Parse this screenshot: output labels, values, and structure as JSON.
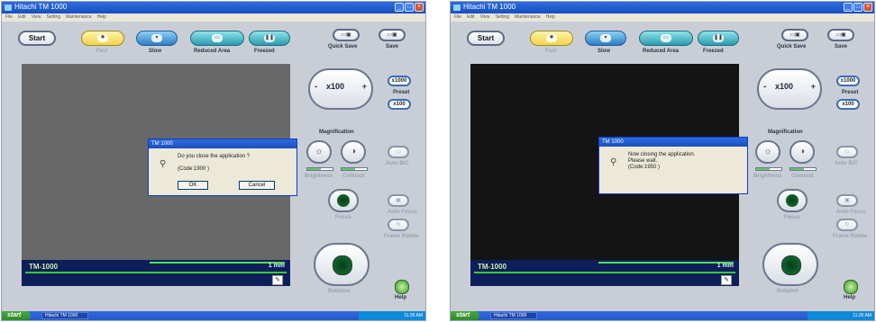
{
  "panels": [
    {
      "title": "Hitachi TM 1000",
      "menu": [
        "File",
        "Edit",
        "View",
        "Setting",
        "Maintenance",
        "Help"
      ],
      "toolbar": {
        "start": "Start",
        "fast": "Fast",
        "slow": "Slow",
        "reduced_area": "Reduced Area",
        "freezed": "Freezed",
        "quick_save": "Quick Save",
        "save": "Save"
      },
      "magnification": {
        "value": "x100",
        "minus": "-",
        "plus": "+",
        "label": "Magnification"
      },
      "preset": {
        "x1000": "x1000",
        "label": "Preset",
        "x100": "x100"
      },
      "controls": {
        "brightness": "Brightness",
        "contrast": "Contrast",
        "auto_bc": "Auto B/C",
        "focus": "Focus",
        "auto_focus": "Auto Focus",
        "frame_rotation": "Frame Rotate",
        "rotation": "Rotation",
        "help": "Help"
      },
      "status": {
        "model": "TM-1000",
        "scale": "1 mm"
      },
      "dialog": {
        "title": "TM 1000",
        "message": "Do you close the application ?",
        "code": "(Code:1900 )",
        "ok": "OK",
        "cancel": "Cancel"
      },
      "taskbar": {
        "start": "start",
        "task": "Hitachi TM 1000",
        "clock": "11:26 AM"
      }
    },
    {
      "title": "Hitachi TM 1000",
      "menu": [
        "File",
        "Edit",
        "View",
        "Setting",
        "Maintenance",
        "Help"
      ],
      "toolbar": {
        "start": "Start",
        "fast": "Fast",
        "slow": "Slow",
        "reduced_area": "Reduced Area",
        "freezed": "Freezed",
        "quick_save": "Quick Save",
        "save": "Save"
      },
      "magnification": {
        "value": "x100",
        "minus": "-",
        "plus": "+",
        "label": "Magnification"
      },
      "preset": {
        "x1000": "x1000",
        "label": "Preset",
        "x100": "x100"
      },
      "controls": {
        "brightness": "Brightness",
        "contrast": "Contrast",
        "auto_bc": "Auto B/C",
        "focus": "Focus",
        "auto_focus": "Auto Focus",
        "frame_rotation": "Frame Rotate",
        "rotation": "Rotation",
        "help": "Help"
      },
      "status": {
        "model": "TM-1000",
        "scale": "1 mm"
      },
      "dialog": {
        "title": "TM 1000",
        "line1": "Now closing the application.",
        "line2": "Please wait.",
        "code": "(Code:1950 )"
      },
      "taskbar": {
        "start": "start",
        "task": "Hitachi TM 1000",
        "clock": "11:26 AM"
      }
    }
  ]
}
